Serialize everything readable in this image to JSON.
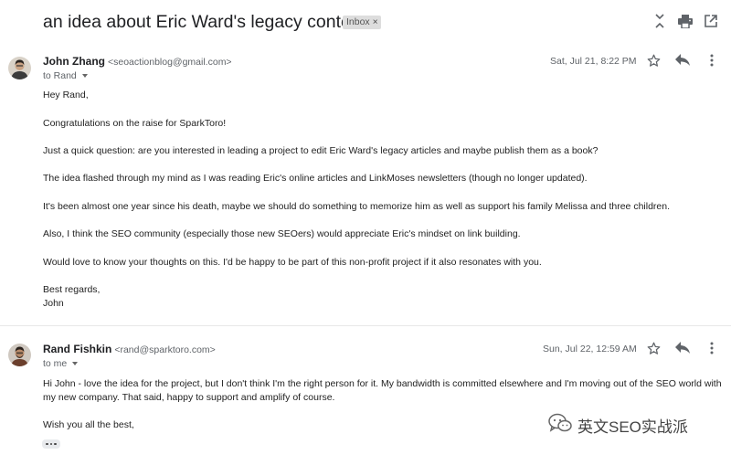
{
  "thread": {
    "subject": "an idea about Eric Ward's legacy content",
    "label": "Inbox",
    "label_remove": "×",
    "icons": [
      "collapse-all-icon",
      "print-icon",
      "open-in-new-window-icon"
    ]
  },
  "messages": [
    {
      "sender_name": "John Zhang",
      "sender_email": "<seoactionblog@gmail.com>",
      "recipient": "to Rand",
      "date": "Sat, Jul 21, 8:22 PM",
      "body": [
        "Hey Rand,",
        "Congratulations on the raise for SparkToro!",
        "Just a quick question: are you interested in leading a project to edit Eric Ward's legacy articles and maybe publish them as a book?",
        "The idea flashed through my mind as I was reading Eric's online articles and LinkMoses newsletters (though no longer updated).",
        "It's been almost one year since his death, maybe we should do something to memorize him as well as support his family Melissa and three children.",
        "Also, I think the SEO community (especially those new SEOers) would appreciate Eric's mindset on link building.",
        "Would love to know your thoughts on this. I'd be happy to be part of this non-profit project if it also resonates with you.",
        "Best regards,",
        "John"
      ]
    },
    {
      "sender_name": "Rand Fishkin",
      "sender_email": "<rand@sparktoro.com>",
      "recipient": "to me",
      "date": "Sun, Jul 22, 12:59 AM",
      "body": [
        "Hi John - love the idea for the project, but I don't think I'm the right person for it. My bandwidth is committed elsewhere and I'm moving out of the SEO world with",
        "my new company. That said, happy to support and amplify of course.",
        "Wish you all the best,"
      ]
    }
  ],
  "watermark": {
    "text": "英文SEO实战派",
    "icon": "wechat-icon"
  },
  "colors": {
    "subject": "#202124",
    "secondary_text": "#5f6368",
    "body_text": "#222222",
    "chip_bg": "#dddddd",
    "icon": "#5f6368"
  }
}
